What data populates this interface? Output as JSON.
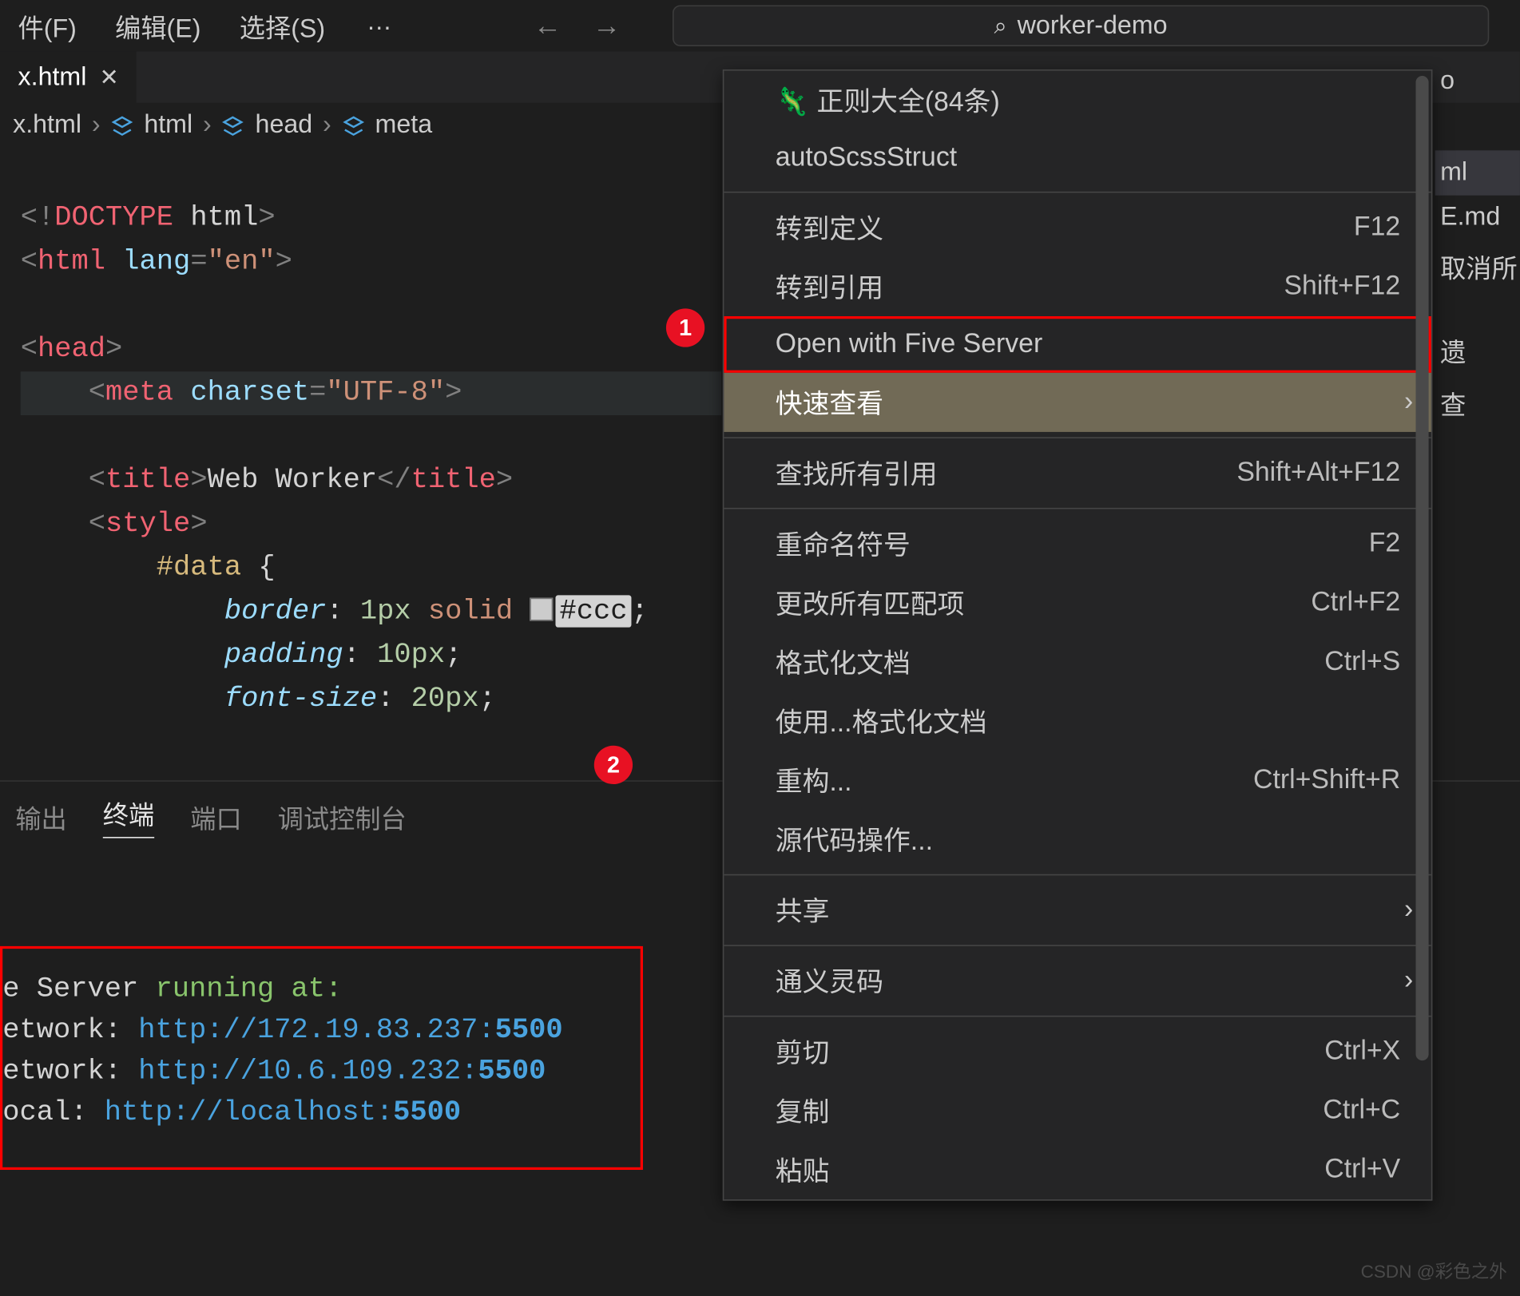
{
  "menubar": {
    "file": "件(F)",
    "edit": "编辑(E)",
    "select": "选择(S)",
    "overflow": "…"
  },
  "search": {
    "placeholder": "worker-demo"
  },
  "tab": {
    "label": "x.html"
  },
  "breadcrumb": {
    "file": "x.html",
    "b1": "html",
    "b2": "head",
    "b3": "meta"
  },
  "code": {
    "doctype_bang": "<!",
    "doctype": "DOCTYPE",
    "doctype_html": " html",
    "doctype_close": ">",
    "html_open_lt": "<",
    "html": "html",
    "lang_attr": "lang",
    "lang_eq": "=",
    "lang_val": "\"en\"",
    "gt": ">",
    "head": "head",
    "meta": "meta",
    "charset_attr": "charset",
    "charset_val": "\"UTF-8\"",
    "title": "title",
    "title_text": "Web Worker",
    "style": "style",
    "selector": "#data",
    "brace_open": " {",
    "p_border": "border",
    "v_border": ": 1px solid ",
    "hex": "#ccc",
    "semi": ";",
    "p_padding": "padding",
    "v_padding": ": 10px;",
    "p_fontsize": "font-size",
    "v_fontsize": ": 20px;"
  },
  "panel": {
    "tab_output": "输出",
    "tab_terminal": "终端",
    "tab_ports": "端口",
    "tab_debug": "调试控制台"
  },
  "terminal": {
    "line0_pre": "e Server ",
    "line0_run": "running at:",
    "l1_label": "etwork:  ",
    "l1_url": "http://172.19.83.237:",
    "l1_port": "5500",
    "l2_label": "etwork:  ",
    "l2_url": "http://10.6.109.232:",
    "l2_port": "5500",
    "l3_label": "ocal:    ",
    "l3_url": "http://localhost:",
    "l3_port": "5500"
  },
  "anno": {
    "one": "1",
    "two": "2"
  },
  "context": {
    "regex_label": "正则大全(84条)",
    "autoscss": "autoScssStruct",
    "goto_def": "转到定义",
    "sc_goto_def": "F12",
    "goto_ref": "转到引用",
    "sc_goto_ref": "Shift+F12",
    "five_server": "Open with Five Server",
    "quick_look": "快速查看",
    "find_refs": "查找所有引用",
    "sc_find_refs": "Shift+Alt+F12",
    "rename": "重命名符号",
    "sc_rename": "F2",
    "change_all": "更改所有匹配项",
    "sc_change_all": "Ctrl+F2",
    "format": "格式化文档",
    "sc_format": "Ctrl+S",
    "format_with": "使用...格式化文档",
    "refactor": "重构...",
    "sc_refactor": "Ctrl+Shift+R",
    "source_action": "源代码操作...",
    "share": "共享",
    "tongyi": "通义灵码",
    "cut": "剪切",
    "sc_cut": "Ctrl+X",
    "copy": "复制",
    "sc_copy": "Ctrl+C",
    "paste": "粘贴",
    "sc_paste": "Ctrl+V"
  },
  "side": {
    "s1": "o",
    "s2": "ml",
    "s3": "E.md",
    "s4": "取消所",
    "s5": "遗",
    "s6": "查"
  },
  "watermark": "CSDN @彩色之外"
}
